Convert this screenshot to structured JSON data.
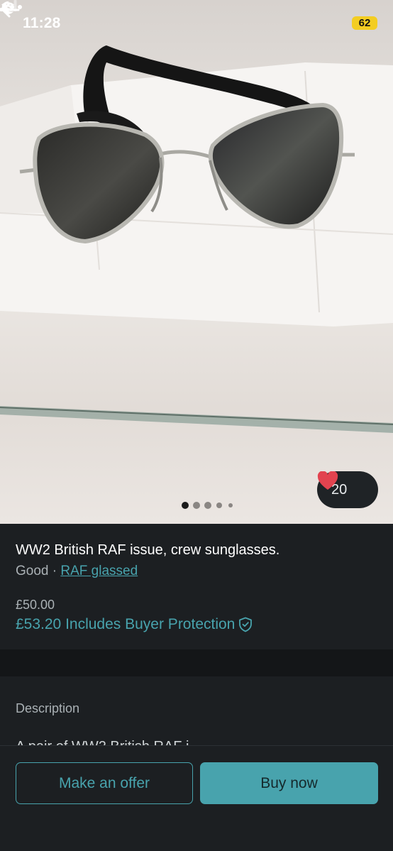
{
  "status_bar": {
    "time": "11:28",
    "battery": "62"
  },
  "listing": {
    "title": "WW2 British RAF issue, crew sunglasses.",
    "condition": "Good",
    "separator": "·",
    "brand": "RAF glassed",
    "price": "£50.00",
    "price_with_protection": "£53.20 Includes Buyer Protection",
    "favorites": "20"
  },
  "gallery": {
    "photo_count": 5,
    "current_index": 0
  },
  "description": {
    "heading": "Description",
    "text": "A pair of WW2 British RAF i..."
  },
  "actions": {
    "offer_label": "Make an offer",
    "buy_label": "Buy now"
  },
  "colors": {
    "accent": "#48a3ad",
    "background": "#1c1f22",
    "heart": "#e2434f",
    "battery": "#f3cd22"
  }
}
